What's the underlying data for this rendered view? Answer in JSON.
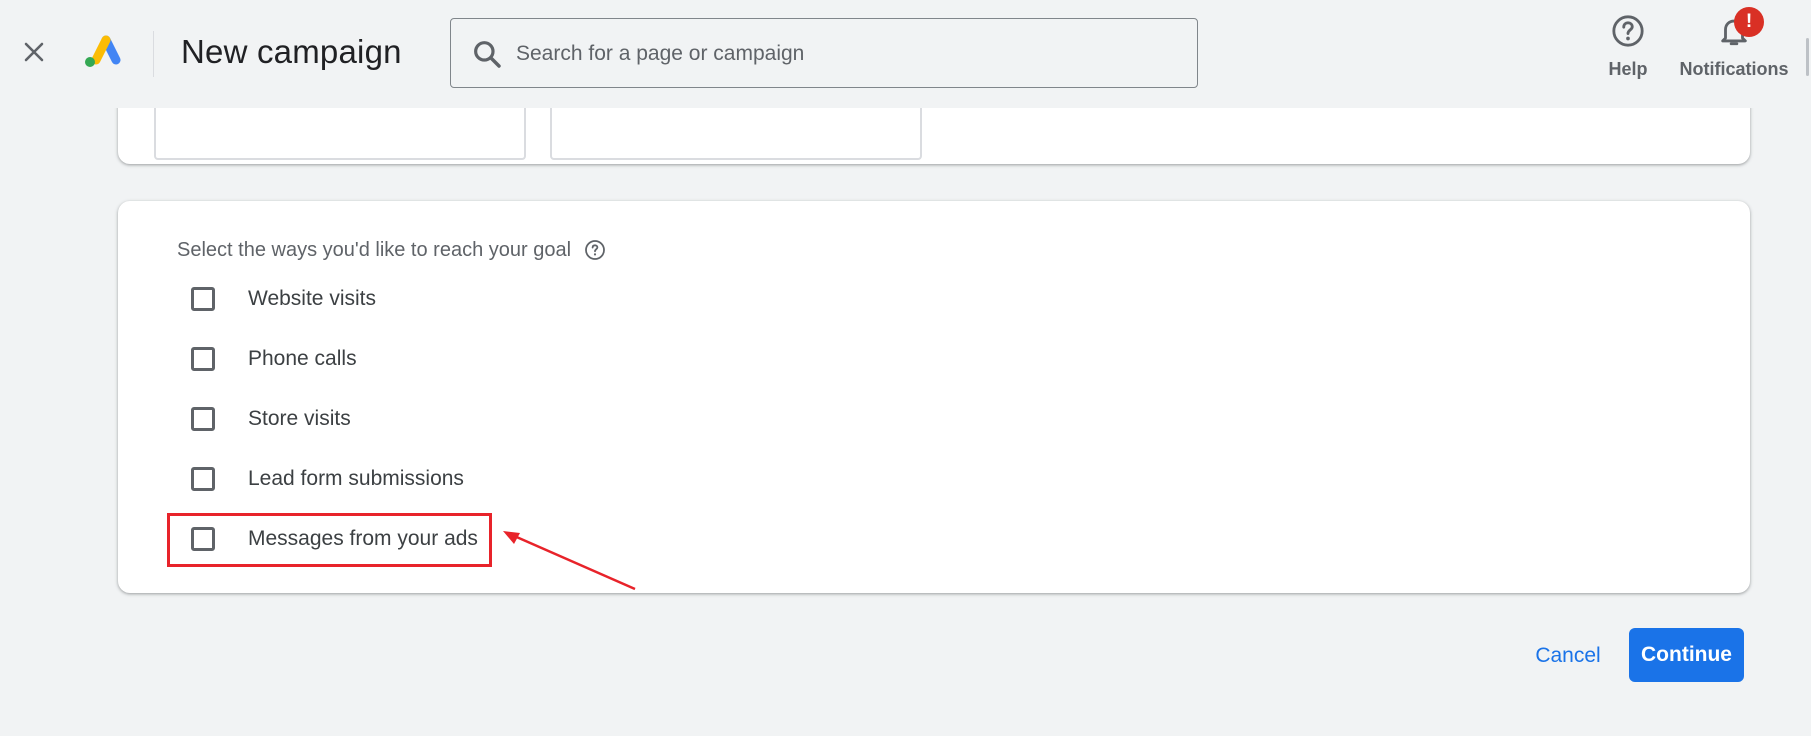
{
  "header": {
    "title": "New campaign",
    "search_placeholder": "Search for a page or campaign",
    "help_label": "Help",
    "notifications_label": "Notifications",
    "notification_badge": "!"
  },
  "goal": {
    "question": "Select the ways you'd like to reach your goal",
    "options": [
      {
        "label": "Website visits",
        "checked": false
      },
      {
        "label": "Phone calls",
        "checked": false
      },
      {
        "label": "Store visits",
        "checked": false
      },
      {
        "label": "Lead form submissions",
        "checked": false
      },
      {
        "label": "Messages from your ads",
        "checked": false
      }
    ]
  },
  "actions": {
    "cancel_label": "Cancel",
    "continue_label": "Continue"
  },
  "colors": {
    "accent": "#1a73e8",
    "annotation_red": "#e8232a",
    "badge_red": "#d93025"
  }
}
